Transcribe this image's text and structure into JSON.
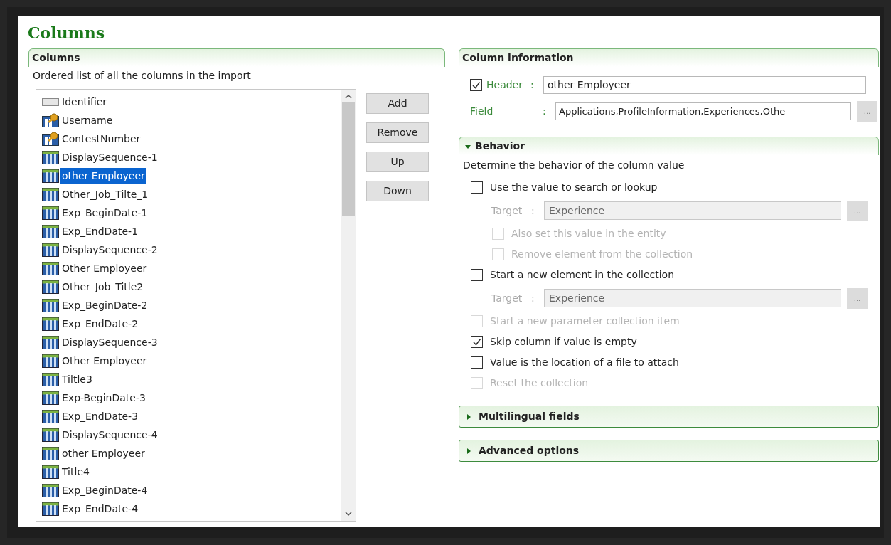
{
  "title": "Columns",
  "columns_panel": {
    "header": "Columns",
    "description": "Ordered list of all the columns in the import",
    "items": [
      {
        "label": "Identifier",
        "kind": "plain",
        "selected": false
      },
      {
        "label": "Username",
        "kind": "key",
        "selected": false
      },
      {
        "label": "ContestNumber",
        "kind": "key",
        "selected": false
      },
      {
        "label": "DisplaySequence-1",
        "kind": "column",
        "selected": false
      },
      {
        "label": "other Employeer",
        "kind": "column",
        "selected": true
      },
      {
        "label": "Other_Job_Tilte_1",
        "kind": "column",
        "selected": false
      },
      {
        "label": "Exp_BeginDate-1",
        "kind": "column",
        "selected": false
      },
      {
        "label": "Exp_EndDate-1",
        "kind": "column",
        "selected": false
      },
      {
        "label": "DisplaySequence-2",
        "kind": "column",
        "selected": false
      },
      {
        "label": "Other Employeer",
        "kind": "column",
        "selected": false
      },
      {
        "label": "Other_Job_Title2",
        "kind": "column",
        "selected": false
      },
      {
        "label": "Exp_BeginDate-2",
        "kind": "column",
        "selected": false
      },
      {
        "label": "Exp_EndDate-2",
        "kind": "column",
        "selected": false
      },
      {
        "label": "DisplaySequence-3",
        "kind": "column",
        "selected": false
      },
      {
        "label": "Other Employeer",
        "kind": "column",
        "selected": false
      },
      {
        "label": "Tiltle3",
        "kind": "column",
        "selected": false
      },
      {
        "label": "Exp-BeginDate-3",
        "kind": "column",
        "selected": false
      },
      {
        "label": "Exp_EndDate-3",
        "kind": "column",
        "selected": false
      },
      {
        "label": "DisplaySequence-4",
        "kind": "column",
        "selected": false
      },
      {
        "label": "other Employeer",
        "kind": "column",
        "selected": false
      },
      {
        "label": "Title4",
        "kind": "column",
        "selected": false
      },
      {
        "label": "Exp_BeginDate-4",
        "kind": "column",
        "selected": false
      },
      {
        "label": "Exp_EndDate-4",
        "kind": "column",
        "selected": false
      }
    ],
    "buttons": [
      "Add",
      "Remove",
      "Up",
      "Down"
    ]
  },
  "column_information": {
    "header": "Column information",
    "header_field": {
      "label": "Header",
      "separator": ":",
      "checked": true,
      "value": "other Employeer"
    },
    "field": {
      "label": "Field",
      "separator": ":",
      "value": "Applications,ProfileInformation,Experiences,Othe",
      "browse": "..."
    }
  },
  "behavior": {
    "header": "Behavior",
    "expanded": true,
    "description": "Determine the behavior of the column value",
    "items": [
      {
        "kind": "checkbox",
        "label": "Use the value to search or lookup",
        "checked": false,
        "disabled": false,
        "children": [
          {
            "kind": "target",
            "label": "Target",
            "separator": ":",
            "value": "Experience",
            "browse": "...",
            "disabled": true
          },
          {
            "kind": "checkbox",
            "label": "Also set this value in the entity",
            "checked": false,
            "disabled": true
          },
          {
            "kind": "checkbox",
            "label": "Remove element from the collection",
            "checked": false,
            "disabled": true
          }
        ]
      },
      {
        "kind": "checkbox",
        "label": "Start a new element in the collection",
        "checked": false,
        "disabled": false,
        "children": [
          {
            "kind": "target",
            "label": "Target",
            "separator": ":",
            "value": "Experience",
            "browse": "...",
            "disabled": true
          }
        ]
      },
      {
        "kind": "checkbox",
        "label": "Start a new parameter collection item",
        "checked": false,
        "disabled": true
      },
      {
        "kind": "checkbox",
        "label": "Skip column if value is empty",
        "checked": true,
        "disabled": false
      },
      {
        "kind": "checkbox",
        "label": "Value is the location of a file to attach",
        "checked": false,
        "disabled": false
      },
      {
        "kind": "checkbox",
        "label": "Reset the collection",
        "checked": false,
        "disabled": true
      }
    ]
  },
  "collapsed_sections": [
    {
      "header": "Multilingual fields",
      "expanded": false
    },
    {
      "header": "Advanced options",
      "expanded": false
    }
  ]
}
